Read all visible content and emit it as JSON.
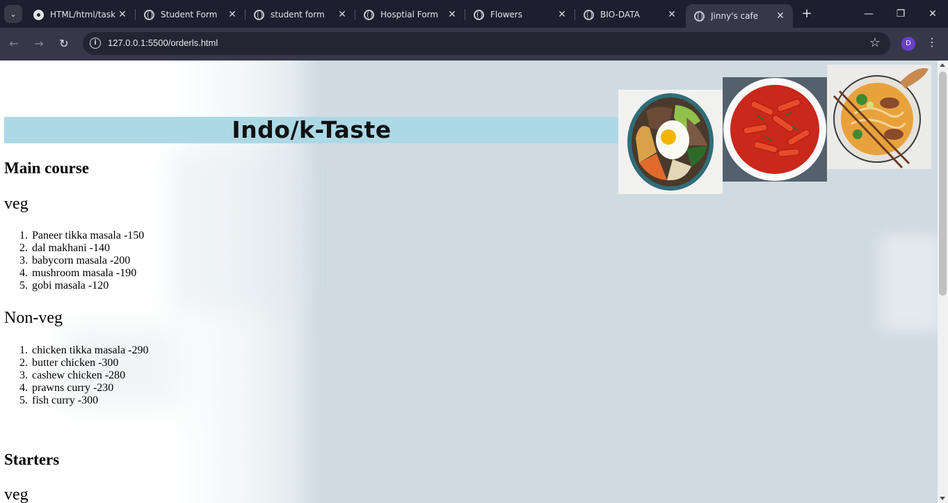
{
  "browser": {
    "tabs": [
      {
        "title": "HTML/html/task",
        "favicon": "github-icon"
      },
      {
        "title": "Student Form",
        "favicon": "globe-icon"
      },
      {
        "title": "student form",
        "favicon": "globe-icon"
      },
      {
        "title": "Hosptial Form",
        "favicon": "globe-icon"
      },
      {
        "title": "Flowers",
        "favicon": "globe-icon"
      },
      {
        "title": "BIO-DATA",
        "favicon": "globe-icon"
      },
      {
        "title": "Jinny's cafe",
        "favicon": "globe-icon",
        "active": true
      }
    ],
    "url": "127.0.0.1:5500/orderls.html",
    "profile_initial": "D",
    "accent": "#6a3fd1"
  },
  "page": {
    "banner_title": "Indo/k-Taste",
    "banner_color": "#add8e6",
    "images": [
      "bibimbap-bowl-image",
      "tteokbokki-bowl-image",
      "noodle-soup-bowl-image"
    ],
    "sections": [
      {
        "heading": "Main course",
        "groups": [
          {
            "label": "veg",
            "items": [
              "Paneer tikka masala -150",
              "dal makhani -140",
              "babycorn masala -200",
              "mushroom masala -190",
              "gobi masala -120"
            ]
          },
          {
            "label": "Non-veg",
            "items": [
              "chicken tikka masala -290",
              "butter chicken -300",
              "cashew chicken -280",
              "prawns curry -230",
              "fish curry -300"
            ]
          }
        ]
      },
      {
        "heading": "Starters",
        "groups": [
          {
            "label": "veg",
            "items": []
          }
        ]
      }
    ]
  }
}
